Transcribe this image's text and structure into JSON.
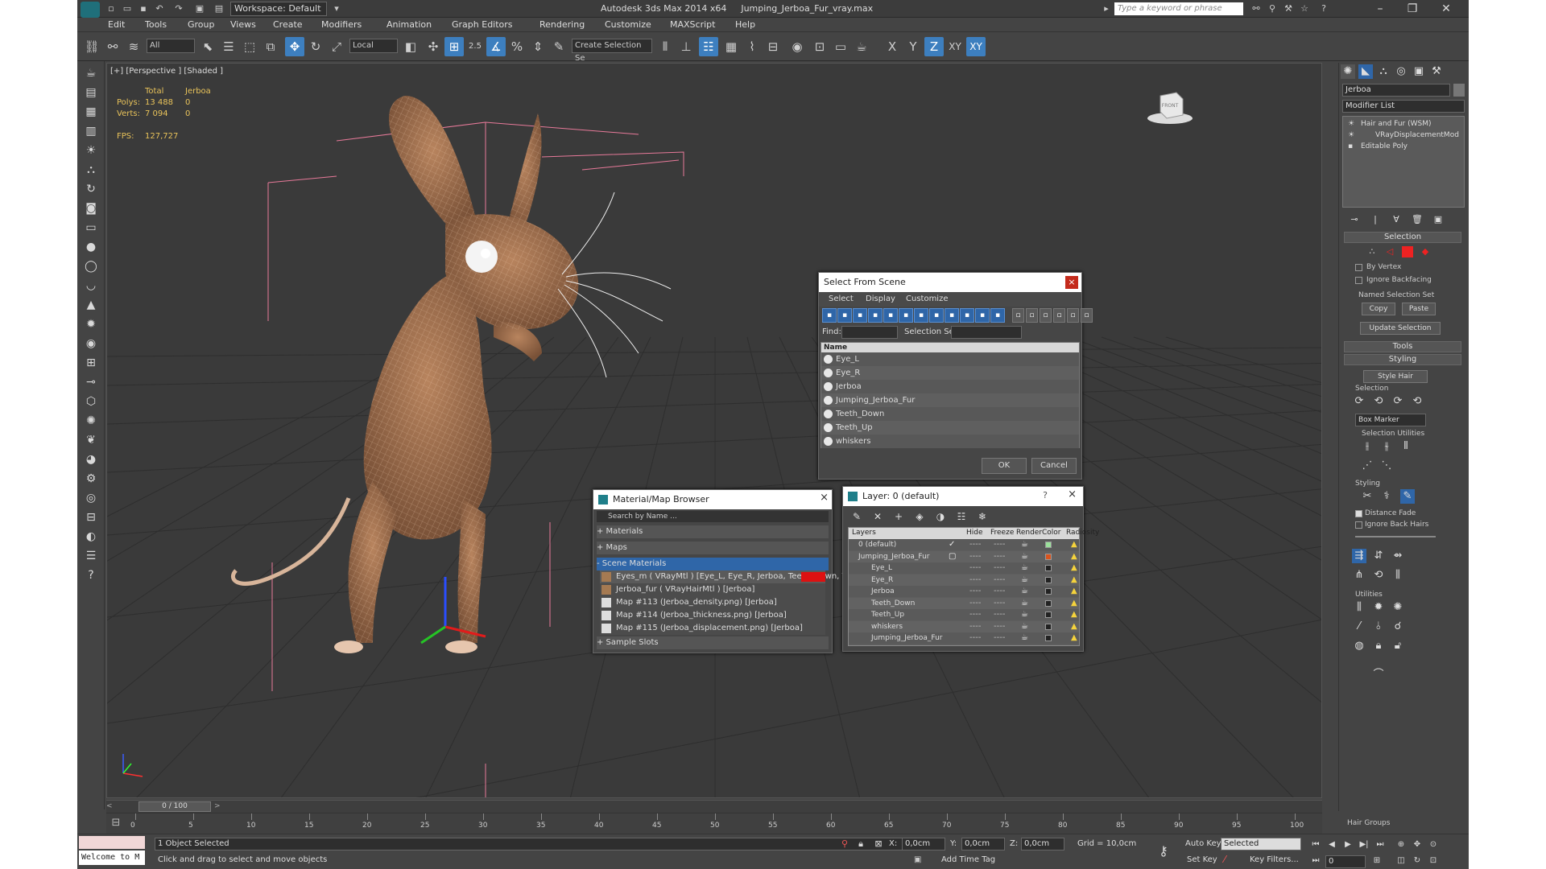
{
  "titlebar": {
    "workspace": "Workspace: Default",
    "app": "Autodesk 3ds Max  2014 x64",
    "file": "Jumping_Jerboa_Fur_vray.max",
    "search_placeholder": "Type a keyword or phrase"
  },
  "menu": [
    "Edit",
    "Tools",
    "Group",
    "Views",
    "Create",
    "Modifiers",
    "Animation",
    "Graph Editors",
    "Rendering",
    "Customize",
    "MAXScript",
    "Help"
  ],
  "toolbar": {
    "filter": "All",
    "coord": "Local",
    "selset": "Create Selection Se",
    "snap_angle": "2.5",
    "axes": [
      "X",
      "Y",
      "Z",
      "XY",
      "XY"
    ]
  },
  "viewport": {
    "label": "[+] [Perspective ] [Shaded ]",
    "stats": {
      "total": "Total",
      "object": "Jerboa",
      "polys_label": "Polys:",
      "polys_total": "13 488",
      "polys_obj": "0",
      "verts_label": "Verts:",
      "verts_total": "7 094",
      "verts_obj": "0",
      "fps_label": "FPS:",
      "fps": "127,727"
    },
    "cube_label": "FRONT"
  },
  "select_scene": {
    "title": "Select From Scene",
    "menu": [
      "Select",
      "Display",
      "Customize"
    ],
    "find_label": "Find:",
    "selset_label": "Selection Set:",
    "col_name": "Name",
    "items": [
      "Eye_L",
      "Eye_R",
      "Jerboa",
      "Jumping_Jerboa_Fur",
      "Teeth_Down",
      "Teeth_Up",
      "whiskers"
    ],
    "ok": "OK",
    "cancel": "Cancel"
  },
  "material_browser": {
    "title": "Material/Map Browser",
    "search": "Search by Name ...",
    "sections": [
      "+ Materials",
      "+ Maps",
      "- Scene Materials"
    ],
    "items": [
      "Eyes_m  ( VRayMtl )  [Eye_L, Eye_R, Jerboa, Teeth_Down, Teet...",
      "Jerboa_fur  ( VRayHairMtl )  [Jerboa]",
      "Map #113 (Jerboa_density.png)  [Jerboa]",
      "Map #114 (Jerboa_thickness.png)  [Jerboa]",
      "Map #115 (Jerboa_displacement.png)  [Jerboa]"
    ],
    "sample": "+ Sample Slots"
  },
  "layer_dialog": {
    "title": "Layer: 0 (default)",
    "help": "?",
    "cols": [
      "Layers",
      "Hide",
      "Freeze",
      "Render",
      "Color",
      "Radiosity"
    ],
    "rows": [
      {
        "name": "0 (default)",
        "indent": 0,
        "color": "#9be09b"
      },
      {
        "name": "Jumping_Jerboa_Fur",
        "indent": 0,
        "color": "#d9541e"
      },
      {
        "name": "Eye_L",
        "indent": 1,
        "color": "#222222"
      },
      {
        "name": "Eye_R",
        "indent": 1,
        "color": "#222222"
      },
      {
        "name": "Jerboa",
        "indent": 1,
        "color": "#222222"
      },
      {
        "name": "Teeth_Down",
        "indent": 1,
        "color": "#222222"
      },
      {
        "name": "Teeth_Up",
        "indent": 1,
        "color": "#222222"
      },
      {
        "name": "whiskers",
        "indent": 1,
        "color": "#222222"
      },
      {
        "name": "Jumping_Jerboa_Fur",
        "indent": 1,
        "color": "#222222"
      }
    ]
  },
  "cmd": {
    "object_name": "Jerboa",
    "modifier_list": "Modifier List",
    "stack": [
      "Hair and Fur (WSM)",
      "VRayDisplacementMod",
      "Editable Poly"
    ],
    "selection": "Selection",
    "by_vertex": "By Vertex",
    "ignore_backfacing": "Ignore Backfacing",
    "named_sel": "Named Selection Set",
    "copy": "Copy",
    "paste": "Paste",
    "update_sel": "Update Selection",
    "tools": "Tools",
    "styling": "Styling",
    "style_hair": "Style Hair",
    "sel_label": "Selection",
    "box_marker": "Box Marker",
    "sel_utils": "Selection Utilities",
    "styling2": "Styling",
    "distance_fade": "Distance Fade",
    "ignore_back_hairs": "Ignore Back Hairs",
    "utilities": "Utilities",
    "hair_groups": "Hair Groups"
  },
  "timeline": {
    "frame": "0 / 100",
    "ticks": [
      "0",
      "5",
      "10",
      "15",
      "20",
      "25",
      "30",
      "35",
      "40",
      "45",
      "50",
      "55",
      "60",
      "65",
      "70",
      "75",
      "80",
      "85",
      "90",
      "95",
      "100"
    ]
  },
  "status": {
    "welcome": "Welcome to M",
    "selected": "1 Object Selected",
    "prompt": "Click and drag to select and move objects",
    "x_label": "X:",
    "x": "0,0cm",
    "y_label": "Y:",
    "y": "0,0cm",
    "z_label": "Z:",
    "z": "0,0cm",
    "grid": "Grid = 10,0cm",
    "autokey": "Auto Key",
    "selected_dd": "Selected",
    "setkey": "Set Key",
    "keyfilters": "Key Filters...",
    "addtimetag": "Add Time Tag",
    "frame_field": "0"
  },
  "colors": {
    "accent": "#3d7fbf",
    "stats": "#e9c35a",
    "wire": "#e6b48f"
  }
}
